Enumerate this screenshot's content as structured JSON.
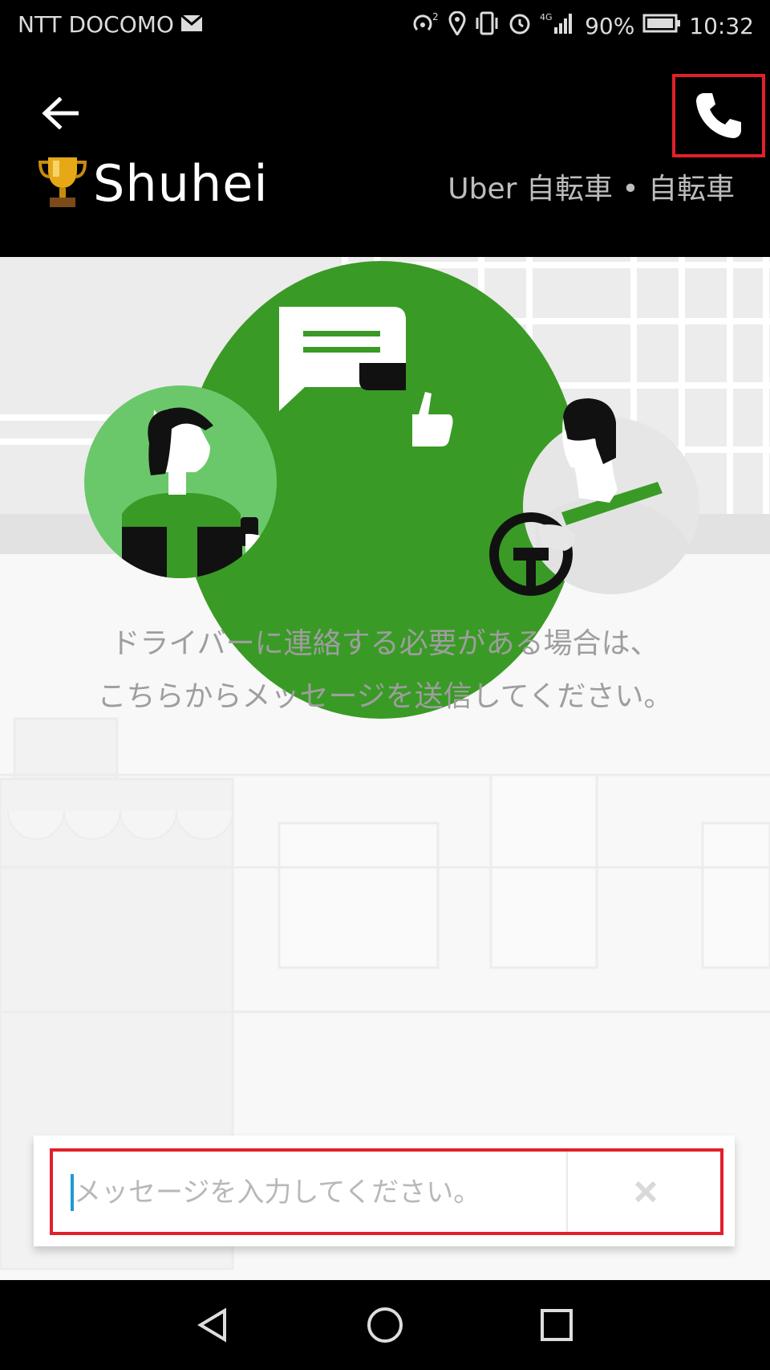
{
  "status_bar": {
    "carrier": "NTT DOCOMO",
    "network": "4G",
    "battery": "90%",
    "time": "10:32"
  },
  "header": {
    "driver_name": "Shuhei",
    "vehicle": "Uber 自転車 • 自転車"
  },
  "main": {
    "prompt_line1": "ドライバーに連絡する必要がある場合は、",
    "prompt_line2": "こちらからメッセージを送信してください。"
  },
  "composer": {
    "placeholder": "メッセージを入力してください。",
    "value": ""
  },
  "colors": {
    "accent_green": "#3a9a26",
    "light_green": "#6bc86a",
    "highlight_red": "#e0202a",
    "caret_blue": "#1e9bd0"
  },
  "icons": [
    "mail-icon",
    "hotspot-icon",
    "location-icon",
    "vibrate-icon",
    "alarm-icon",
    "signal-icon",
    "battery-icon",
    "back-arrow-icon",
    "phone-icon",
    "trophy-icon",
    "close-icon",
    "nav-back-icon",
    "nav-home-icon",
    "nav-recents-icon"
  ]
}
